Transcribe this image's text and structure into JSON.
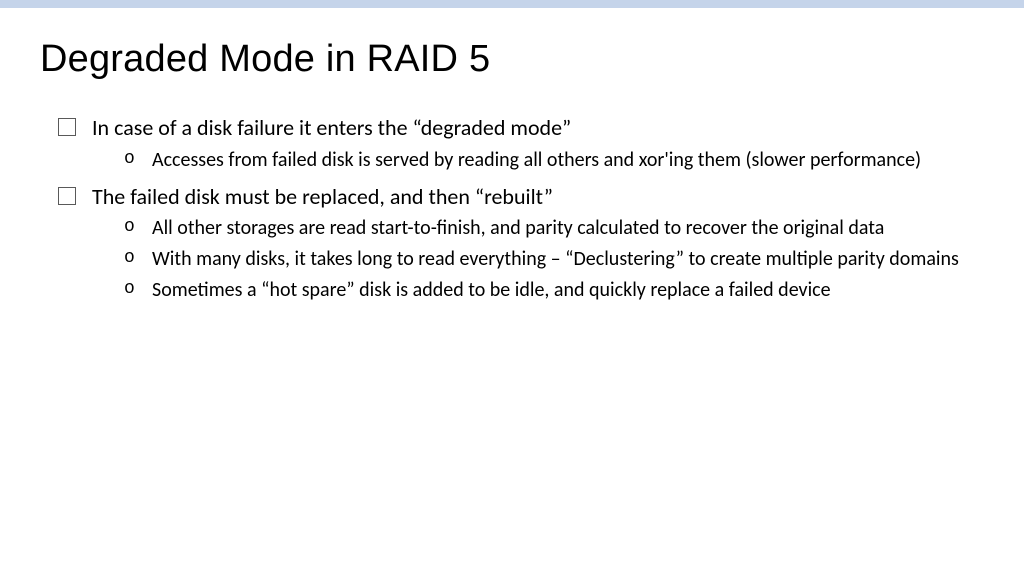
{
  "slide": {
    "title": "Degraded Mode in RAID 5",
    "bullets": [
      {
        "text": "In case of a disk failure it enters the “degraded mode”",
        "subs": [
          "Accesses from failed disk is served by reading all others and xor'ing them (slower performance)"
        ]
      },
      {
        "text": "The failed disk must be replaced, and then “rebuilt”",
        "subs": [
          "All other storages are read start-to-finish, and parity calculated to recover the original data",
          "With many disks, it takes long to read everything – “Declustering” to create multiple parity domains",
          "Sometimes a “hot spare” disk is added to be idle, and quickly replace a failed device"
        ]
      }
    ]
  }
}
